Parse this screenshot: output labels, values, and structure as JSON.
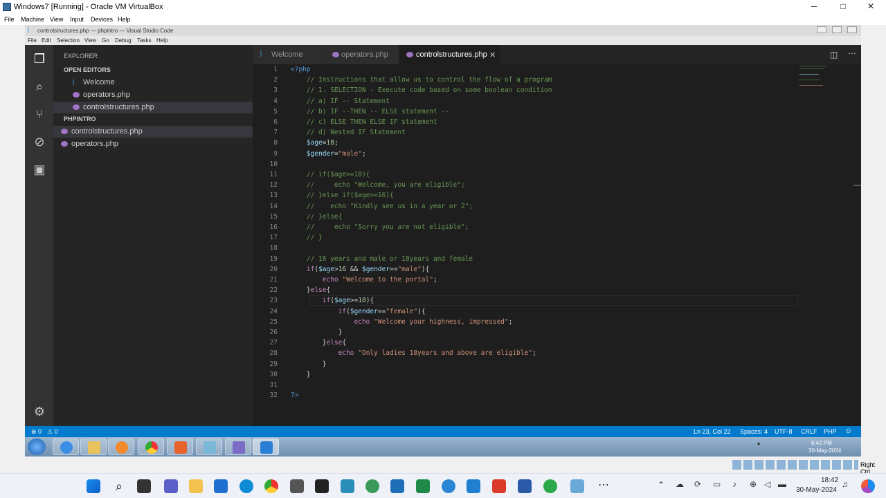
{
  "host": {
    "title": "Windows7 [Running] - Oracle VM VirtualBox",
    "menu": [
      "File",
      "Machine",
      "View",
      "Input",
      "Devices",
      "Help"
    ],
    "controls": {
      "minimize": "─",
      "maximize": "□",
      "close": "✕"
    }
  },
  "vscode": {
    "title": "controlstructures.php — phpintro — Visual Studio Code",
    "menu": [
      "File",
      "Edit",
      "Selection",
      "View",
      "Go",
      "Debug",
      "Tasks",
      "Help"
    ],
    "explorer_label": "EXPLORER",
    "open_editors_label": "OPEN EDITORS",
    "open_editors": [
      "Welcome",
      "operators.php",
      "controlstructures.php"
    ],
    "project_label": "PHPINTRO",
    "project_files": [
      "controlstructures.php",
      "operators.php"
    ],
    "tabs": [
      {
        "label": "Welcome"
      },
      {
        "label": "operators.php"
      },
      {
        "label": "controlstructures.php",
        "close": "✕"
      }
    ],
    "code_lines": [
      "<?php",
      "    // Instructions that allow us to control the flow of a program",
      "    // 1. SELECTION - Execute code based on some boolean condition",
      "    // a) IF -- Statement",
      "    // b) IF --THEN -- ELSE statement --",
      "    // c) ELSE THEN ELSE IF statement",
      "    // d) Nested IF Statement",
      "    $age=18;",
      "    $gender=\"male\";",
      "",
      "    // if($age>=18){",
      "    //     echo \"Welcome, you are eligible\";",
      "    // }else if($age>=16){",
      "    //    echo \"Kindly see us in a year or 2\";",
      "    // }else{",
      "    //     echo \"Sorry you are not eligible\";",
      "    // }",
      "",
      "    // 16 years and male or 18years and female",
      "    if($age>16 && $gender==\"male\"){",
      "        echo \"Welcome to the portal\";",
      "    }else{",
      "        if($age>=18){",
      "            if($gender==\"female\"){",
      "                echo \"Welcome your highness, impressed\";",
      "            }",
      "        }else{",
      "            echo \"Only ladies 18years and above are eligible\";",
      "        }",
      "    }",
      "",
      "?>"
    ],
    "status": {
      "errors": "⊗ 0",
      "warnings": "⚠ 0",
      "position": "Ln 23, Col 22",
      "spaces": "Spaces: 4",
      "encoding": "UTF-8",
      "eol": "CRLF",
      "language": "PHP",
      "feedback": "☺"
    }
  },
  "guest_taskbar": {
    "time": "6:42 PM",
    "date": "30-May-2024"
  },
  "host_strip": {
    "hostkey": "Right Ctrl"
  },
  "host_taskbar": {
    "time": "18:42",
    "date": "30-May-2024"
  },
  "colors": {
    "statusbar": "#007acc",
    "editor_bg": "#1e1e1e",
    "sidebar_bg": "#252526",
    "comment": "#6a9955",
    "string": "#ce9178",
    "variable": "#9cdcfe"
  }
}
